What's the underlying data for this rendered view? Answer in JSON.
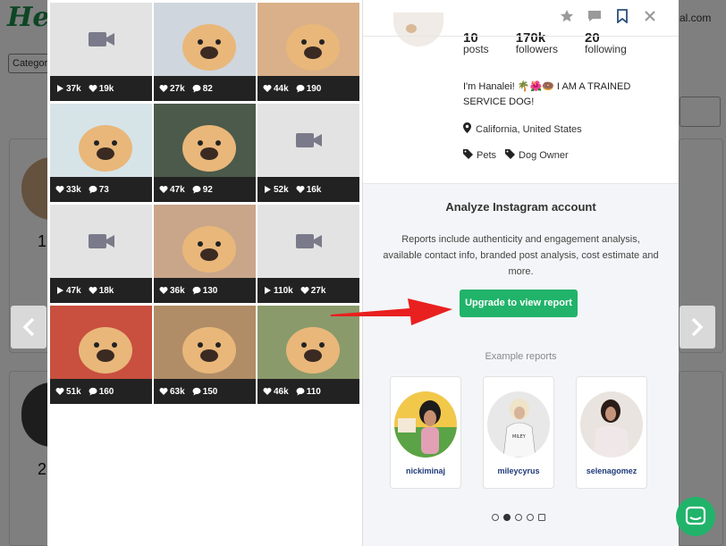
{
  "background": {
    "logo": "Heep",
    "category_button": "Categories",
    "right_text": "al.com",
    "numbers": [
      "1",
      "2"
    ]
  },
  "grid": {
    "tiles": [
      {
        "type": "video",
        "plays": "37k",
        "likes": "19k"
      },
      {
        "type": "photo",
        "likes": "27k",
        "comments": "82",
        "color": "#cfd6dd"
      },
      {
        "type": "photo",
        "likes": "44k",
        "comments": "190",
        "color": "#d9b089"
      },
      {
        "type": "photo",
        "likes": "33k",
        "comments": "73",
        "color": "#d6e4e8"
      },
      {
        "type": "photo",
        "likes": "47k",
        "comments": "92",
        "color": "#4b5a4a"
      },
      {
        "type": "video",
        "plays": "52k",
        "likes": "16k"
      },
      {
        "type": "video",
        "plays": "47k",
        "likes": "18k"
      },
      {
        "type": "photo",
        "likes": "36k",
        "comments": "130",
        "color": "#c9a68a"
      },
      {
        "type": "video",
        "plays": "110k",
        "likes": "27k"
      },
      {
        "type": "photo",
        "likes": "51k",
        "comments": "160",
        "color": "#c94f3f"
      },
      {
        "type": "photo",
        "likes": "63k",
        "comments": "150",
        "color": "#b08d67"
      },
      {
        "type": "photo",
        "likes": "46k",
        "comments": "110",
        "color": "#8a9a6a"
      }
    ]
  },
  "profile": {
    "posts_value": "10",
    "posts_label": "posts",
    "followers_value": "170k",
    "followers_label": "followers",
    "following_value": "20",
    "following_label": "following",
    "bio": "I'm Hanalei! 🌴🌺🍩 I AM A TRAINED SERVICE DOG!",
    "location": "California, United States",
    "tags": [
      "Pets",
      "Dog Owner"
    ]
  },
  "analyze": {
    "title": "Analyze Instagram account",
    "description": "Reports include authenticity and engagement analysis, available contact info, branded post analysis, cost estimate and more.",
    "button": "Upgrade to view report",
    "examples_label": "Example reports",
    "examples": [
      "nickiminaj",
      "mileycyrus",
      "selenagomez"
    ]
  },
  "colors": {
    "accent": "#21b36a",
    "red_arrow": "#e8201f",
    "link": "#1f3a7a"
  },
  "icons": [
    "star-icon",
    "message-icon",
    "bookmark-icon",
    "close-icon"
  ]
}
